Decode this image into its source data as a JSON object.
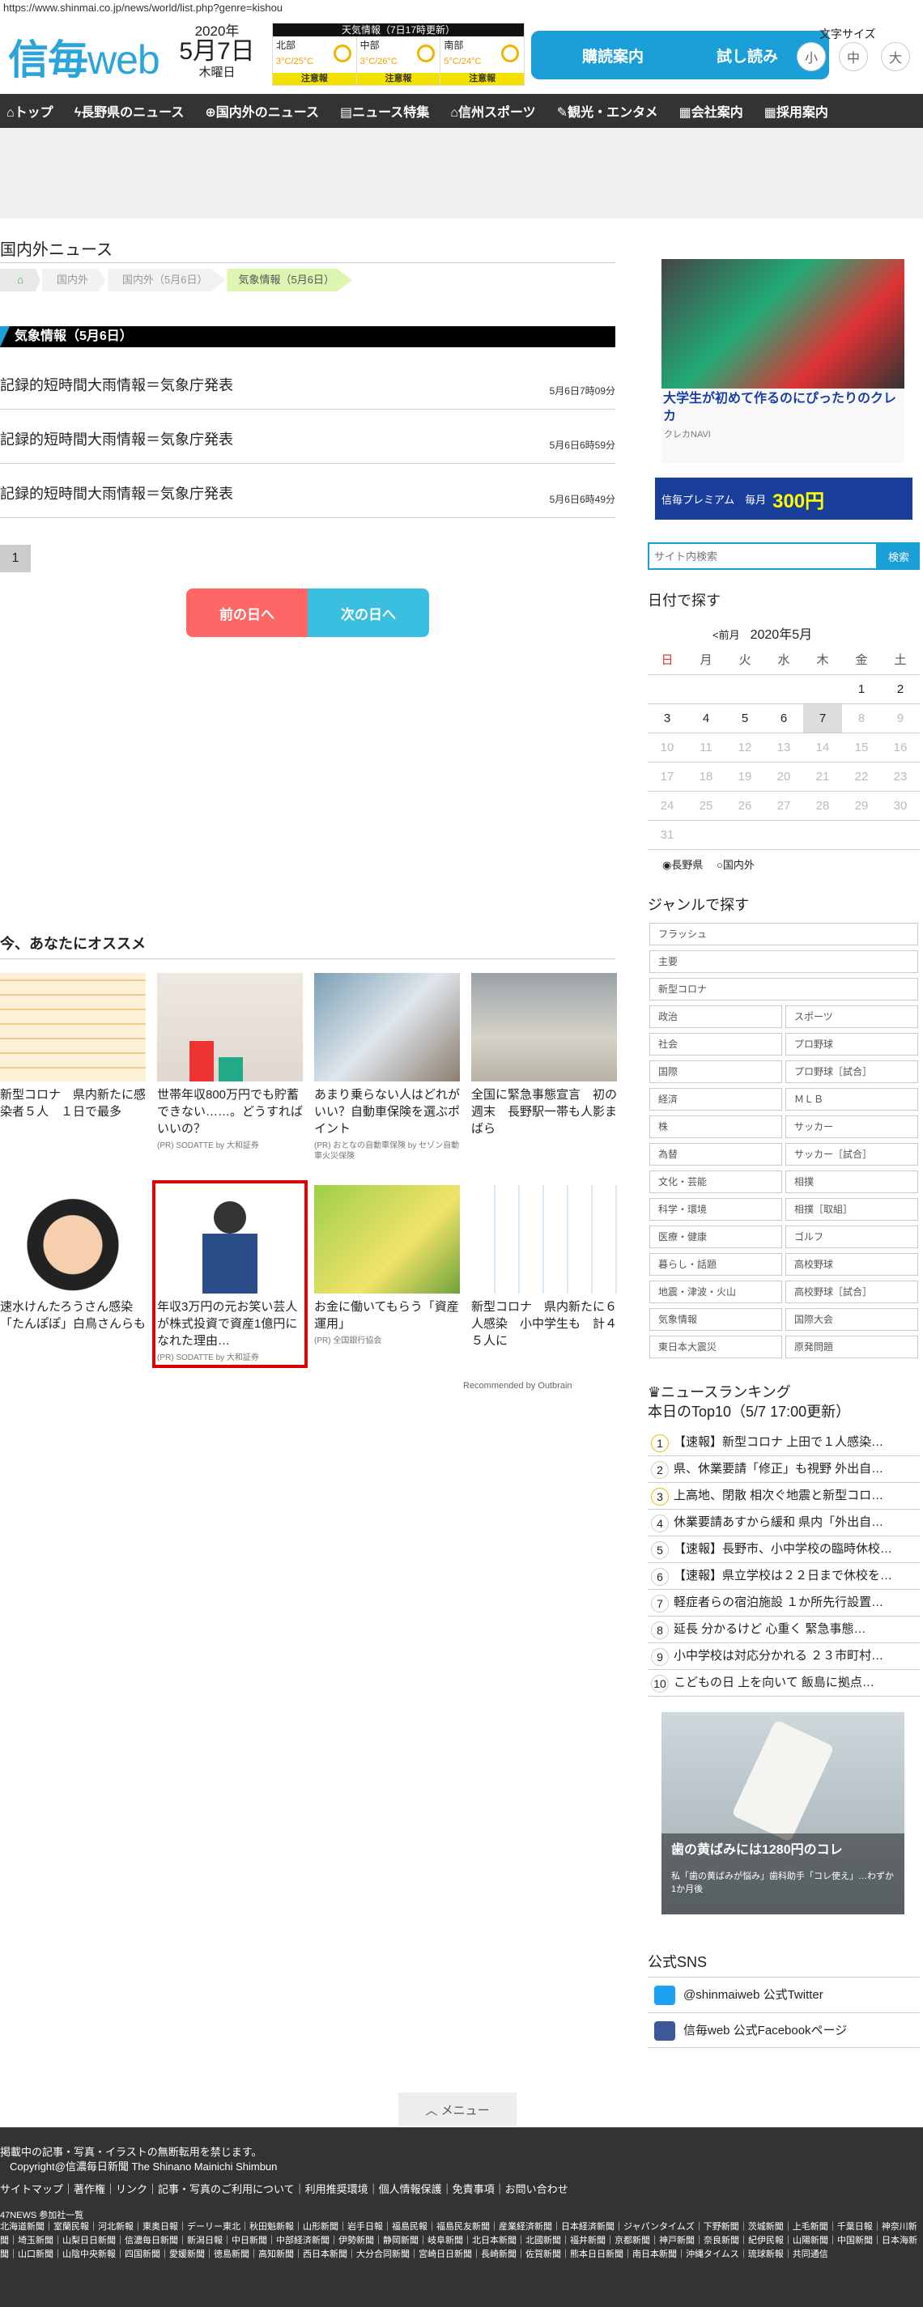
{
  "url": "https://www.shinmai.co.jp/news/world/list.php?genre=kishou",
  "header": {
    "logo_main": "信毎",
    "logo_web": "web",
    "year": "2020年",
    "monthday": "5月7日",
    "weekday": "木曜日",
    "weather": {
      "title": "天気情報（7日17時更新）",
      "regions": [
        {
          "name": "北部",
          "temp": "3°C/25°C",
          "warn": "注意報"
        },
        {
          "name": "中部",
          "temp": "3°C/26°C",
          "warn": "注意報"
        },
        {
          "name": "南部",
          "temp": "5°C/24°C",
          "warn": "注意報"
        }
      ]
    },
    "subscribe_label": "購読案内",
    "trial_label": "試し読み",
    "font_size_label": "文字サイズ",
    "font_sizes": [
      "小",
      "中",
      "大"
    ]
  },
  "nav": [
    "トップ",
    "長野県のニュース",
    "国内外のニュース",
    "ニュース特集",
    "信州スポーツ",
    "観光・エンタメ",
    "会社案内",
    "採用案内"
  ],
  "main": {
    "title": "国内外ニュース",
    "breadcrumb": [
      "国内外",
      "国内外（5月6日）",
      "気象情報（5月6日）"
    ],
    "section_heading": "気象情報（5月6日）",
    "articles": [
      {
        "title": "記録的短時間大雨情報＝気象庁発表",
        "date": "5月6日7時09分"
      },
      {
        "title": "記録的短時間大雨情報＝気象庁発表",
        "date": "5月6日6時59分"
      },
      {
        "title": "記録的短時間大雨情報＝気象庁発表",
        "date": "5月6日6時49分"
      }
    ],
    "page": "1",
    "prev_label": "前の日へ",
    "next_label": "次の日へ"
  },
  "recommend": {
    "title": "今、あなたにオススメ",
    "cards": [
      {
        "title": "新型コロナ　県内新たに感染者５人　１日で最多",
        "sponsor": ""
      },
      {
        "title": "世帯年収800万円でも貯蓄できない……。どうすればいいの？",
        "sponsor": "(PR) SODATTE by 大和証券"
      },
      {
        "title": "あまり乗らない人はどれがいい？自動車保険を選ぶポイント",
        "sponsor": "(PR) おとなの自動車保険 by セゾン自動車火災保険"
      },
      {
        "title": "全国に緊急事態宣言　初の週末　長野駅一帯も人影まばら",
        "sponsor": ""
      },
      {
        "title": "速水けんたろうさん感染　「たんぽぽ」白鳥さんらも",
        "sponsor": ""
      },
      {
        "title": "年収3万円の元お笑い芸人が株式投資で資産1億円になれた理由…",
        "sponsor": "(PR) SODATTE by 大和証券"
      },
      {
        "title": "お金に働いてもらう「資産運用」",
        "sponsor": "(PR) 全国銀行協会"
      },
      {
        "title": "新型コロナ　県内新たに６人感染　小中学生も　計４５人に",
        "sponsor": ""
      }
    ],
    "outbrain": "Recommended by Outbrain"
  },
  "sidebar": {
    "ad1_title": "大学生が初めて作るのにぴったりのクレカ",
    "ad1_source": "クレカNAVI",
    "premium_text": "信毎プレミアム　毎月",
    "premium_price": "300円",
    "search_placeholder": "サイト内検索",
    "search_button": "検索",
    "date_title": "日付で探す",
    "cal_prev": "<前月",
    "cal_month": "2020年5月",
    "cal_week": [
      "日",
      "月",
      "火",
      "水",
      "木",
      "金",
      "土"
    ],
    "cal_rows": [
      [
        "",
        "",
        "",
        "",
        "",
        "1",
        "2"
      ],
      [
        "3",
        "4",
        "5",
        "6",
        "7",
        "8",
        "9"
      ],
      [
        "10",
        "11",
        "12",
        "13",
        "14",
        "15",
        "16"
      ],
      [
        "17",
        "18",
        "19",
        "20",
        "21",
        "22",
        "23"
      ],
      [
        "24",
        "25",
        "26",
        "27",
        "28",
        "29",
        "30"
      ],
      [
        "31",
        "",
        "",
        "",
        "",
        "",
        ""
      ]
    ],
    "cal_filter": [
      "長野県",
      "国内外"
    ],
    "genre_title": "ジャンルで探す",
    "genres_full": [
      "フラッシュ",
      "主要",
      "新型コロナ"
    ],
    "genres_pairs": [
      [
        "政治",
        "スポーツ"
      ],
      [
        "社会",
        "プロ野球"
      ],
      [
        "国際",
        "プロ野球［試合］"
      ],
      [
        "経済",
        "ＭＬＢ"
      ],
      [
        "株",
        "サッカー"
      ],
      [
        "為替",
        "サッカー［試合］"
      ],
      [
        "文化・芸能",
        "相撲"
      ],
      [
        "科学・環境",
        "相撲［取組］"
      ],
      [
        "医療・健康",
        "ゴルフ"
      ],
      [
        "暮らし・話題",
        "高校野球"
      ],
      [
        "地震・津波・火山",
        "高校野球［試合］"
      ],
      [
        "気象情報",
        "国際大会"
      ],
      [
        "東日本大震災",
        "原発問題"
      ]
    ],
    "ranking_title": "ニュースランキング",
    "ranking_sub": "本日のTop10（5/7 17:00更新）",
    "ranking": [
      "【速報】新型コロナ 上田で１人感染…",
      "県、休業要請「修正」も視野 外出自…",
      "上高地、閉散 相次ぐ地震と新型コロ…",
      "休業要請あすから緩和 県内「外出自…",
      "【速報】長野市、小中学校の臨時休校…",
      "【速報】県立学校は２２日まで休校を…",
      "軽症者らの宿泊施設 １か所先行設置…",
      "延長 分かるけど 心重く 緊急事態…",
      "小中学校は対応分かれる ２３市町村…",
      "こどもの日 上を向いて 飯島に拠点…"
    ],
    "ad2_title": "歯の黄ばみには1280円のコレ",
    "ad2_sub": "私「歯の黄ばみが悩み」歯科助手「コレ使え」…わずか1か月後",
    "sns_title": "公式SNS",
    "sns": [
      "@shinmaiweb 公式Twitter",
      "信毎web 公式Facebookページ"
    ]
  },
  "menu_label": "メニュー",
  "footer": {
    "notice": "掲載中の記事・写真・イラストの無断転用を禁じます。",
    "copyright": "Copyright@信濃毎日新聞 The Shinano Mainichi Shimbun",
    "links": "サイトマップ｜著作権｜リンク｜記事・写真のご利用について｜利用推奨環境｜個人情報保護｜免責事項｜お問い合わせ",
    "news47": "47NEWS 参加社一覧",
    "members": "北海道新聞｜室蘭民報｜河北新報｜東奥日報｜デーリー東北｜秋田魁新報｜山形新聞｜岩手日報｜福島民報｜福島民友新聞｜産業経済新聞｜日本経済新聞｜ジャパンタイムズ｜下野新聞｜茨城新聞｜上毛新聞｜千葉日報｜神奈川新聞｜埼玉新聞｜山梨日日新聞｜信濃毎日新聞｜新潟日報｜中日新聞｜中部経済新聞｜伊勢新聞｜静岡新聞｜岐阜新聞｜北日本新聞｜北國新聞｜福井新聞｜京都新聞｜神戸新聞｜奈良新聞｜紀伊民報｜山陽新聞｜中国新聞｜日本海新聞｜山口新聞｜山陰中央新報｜四国新聞｜愛媛新聞｜徳島新聞｜高知新聞｜西日本新聞｜大分合同新聞｜宮崎日日新聞｜長崎新聞｜佐賀新聞｜熊本日日新聞｜南日本新聞｜沖縄タイムス｜琉球新報｜共同通信"
  },
  "colors": {
    "brand": "#2ba4dc",
    "nav_bg": "#333333",
    "prev": "#ff6666",
    "next": "#3bbfe0",
    "highlight_border": "#dd0000"
  }
}
